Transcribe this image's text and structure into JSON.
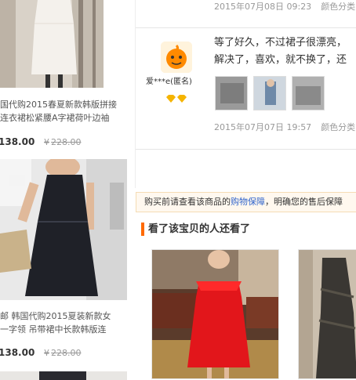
{
  "left_products": [
    {
      "title_line1": "国代购2015春夏新款韩版拼接",
      "title_line2": "连衣裙松紧腰A字裙荷叶边袖",
      "price": "138.00",
      "currency": "¥",
      "old_price": "228.00"
    },
    {
      "title_line1": "邮 韩国代购2015夏装新款女",
      "title_line2": "一字领 吊带裙中长款韩版连",
      "price": "138.00",
      "currency": "¥",
      "old_price": "228.00"
    }
  ],
  "reviews": {
    "prev": {
      "date": "2015年07月08日 09:23",
      "color_label": "颜色分类"
    },
    "current": {
      "username": "爱***e(匿名)",
      "text_line1": "等了好久，不过裙子很漂亮，",
      "text_line2": "解决了，喜欢，就不换了，还",
      "date": "2015年07月07日 19:57",
      "color_label": "颜色分类"
    }
  },
  "notice": {
    "prefix": "购买前请查看该商品的",
    "link": "购物保障",
    "suffix": "，明确您的售后保障"
  },
  "recommend": {
    "title": "看了该宝贝的人还看了"
  },
  "colors": {
    "accent": "#ff6a00",
    "link": "#3366cc",
    "notice_bg": "#fff8ef",
    "muted": "#999999"
  }
}
